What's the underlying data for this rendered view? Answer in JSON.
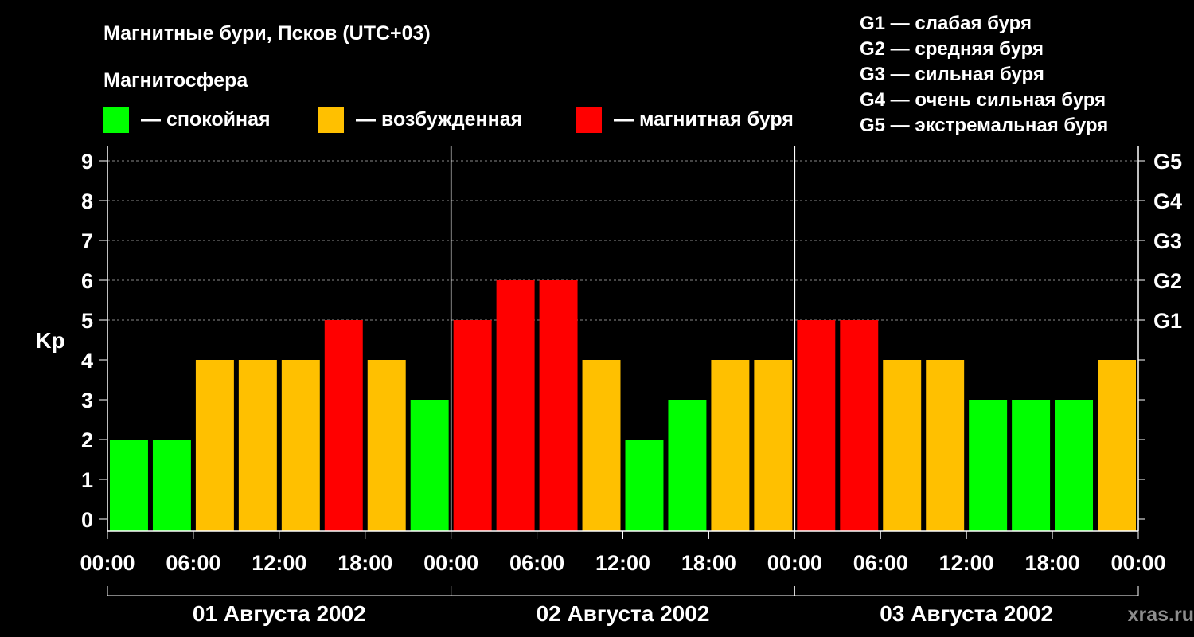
{
  "title": "Магнитные бури, Псков (UTC+03)",
  "legend": {
    "heading": "Магнитосфера",
    "items": [
      {
        "label": "— спокойная",
        "color": "#00ff00"
      },
      {
        "label": "— возбужденная",
        "color": "#ffc000"
      },
      {
        "label": "— магнитная буря",
        "color": "#ff0000"
      }
    ]
  },
  "g_scale_legend": [
    "G1 — слабая буря",
    "G2 — средняя буря",
    "G3 — сильная буря",
    "G4 — очень сильная буря",
    "G5 — экстремальная буря"
  ],
  "watermark": "xras.ru",
  "chart_data": {
    "type": "bar",
    "ylabel": "Kp",
    "ylim": [
      0,
      9
    ],
    "y_ticks": [
      "0",
      "1",
      "2",
      "3",
      "4",
      "5",
      "6",
      "7",
      "8",
      "9"
    ],
    "right_ticks": [
      {
        "value": 5,
        "label": "G1"
      },
      {
        "value": 6,
        "label": "G2"
      },
      {
        "value": 7,
        "label": "G3"
      },
      {
        "value": 8,
        "label": "G4"
      },
      {
        "value": 9,
        "label": "G5"
      }
    ],
    "x_ticks": [
      "00:00",
      "06:00",
      "12:00",
      "18:00",
      "00:00",
      "06:00",
      "12:00",
      "18:00",
      "00:00",
      "06:00",
      "12:00",
      "18:00",
      "00:00"
    ],
    "days": [
      "01 Августа 2002",
      "02 Августа 2002",
      "03 Августа 2002"
    ],
    "values": [
      2,
      2,
      4,
      4,
      4,
      5,
      4,
      3,
      5,
      6,
      6,
      4,
      2,
      3,
      4,
      4,
      5,
      5,
      4,
      4,
      3,
      3,
      3,
      4
    ],
    "color_thresholds": {
      "quiet_max": 3,
      "active": 4,
      "storm_min": 5
    },
    "grid": true
  }
}
